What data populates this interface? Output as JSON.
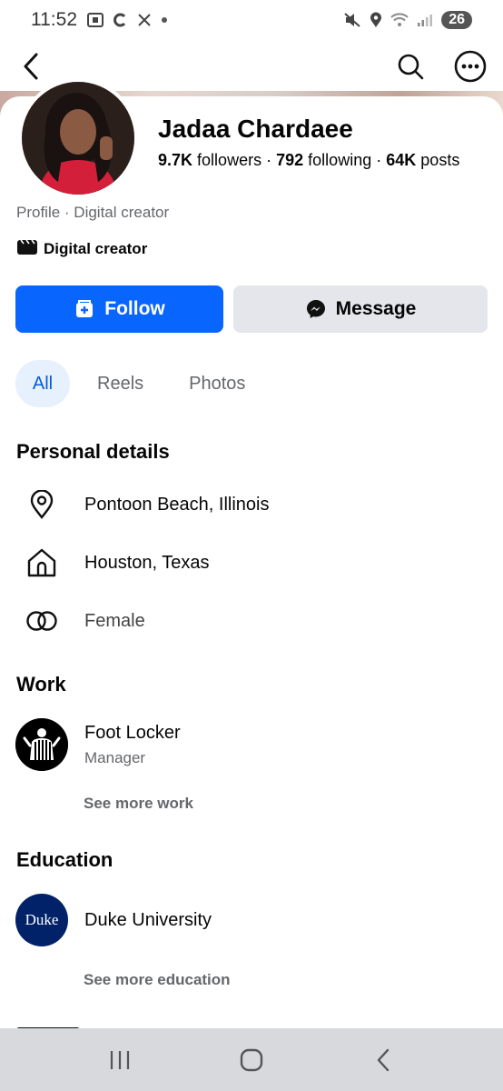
{
  "status_bar": {
    "time": "11:52",
    "battery": "26",
    "icons": [
      "screenshot-icon",
      "c-app-icon",
      "x-app-icon",
      "dot-icon",
      "mute-icon",
      "location-icon",
      "wifi-icon",
      "signal-icon"
    ]
  },
  "profile": {
    "name": "Jadaa Chardaee",
    "followers_count": "9.7K",
    "followers_label": "followers",
    "following_count": "792",
    "following_label": "following",
    "posts_count": "64K",
    "posts_label": "posts",
    "separator": "·",
    "subtitle": "Profile · Digital creator",
    "category": "Digital creator"
  },
  "actions": {
    "follow_label": "Follow",
    "message_label": "Message"
  },
  "tabs": [
    {
      "label": "All",
      "active": true
    },
    {
      "label": "Reels",
      "active": false
    },
    {
      "label": "Photos",
      "active": false
    }
  ],
  "personal_details": {
    "title": "Personal details",
    "items": [
      {
        "icon": "location-pin-icon",
        "text": "Pontoon Beach, Illinois"
      },
      {
        "icon": "home-icon",
        "text": "Houston, Texas"
      },
      {
        "icon": "gender-icon",
        "text": "Female"
      }
    ]
  },
  "work": {
    "title": "Work",
    "org": "Foot Locker",
    "role": "Manager",
    "see_more": "See more work"
  },
  "education": {
    "title": "Education",
    "logo_text": "Duke",
    "org": "Duke University",
    "see_more": "See more education"
  },
  "colors": {
    "primary": "#0866ff",
    "secondary_bg": "#e4e6eb",
    "tab_active_bg": "#e7f0fd",
    "muted_text": "#65676b",
    "duke_blue": "#012169"
  }
}
